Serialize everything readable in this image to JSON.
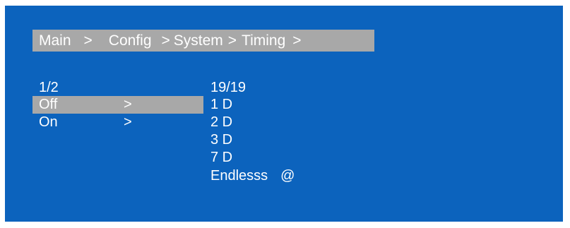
{
  "breadcrumb": {
    "items": [
      "Main",
      ">",
      "Config",
      ">",
      "System",
      ">",
      "Timing",
      ">"
    ]
  },
  "left_menu": {
    "page_indicator": "1/2",
    "items": [
      {
        "label": "Off",
        "arrow": ">",
        "selected": true
      },
      {
        "label": "On",
        "arrow": ">",
        "selected": false
      }
    ]
  },
  "right_menu": {
    "page_indicator": "19/19",
    "items": [
      {
        "label": "1 D",
        "marker": ""
      },
      {
        "label": "2 D",
        "marker": ""
      },
      {
        "label": "3 D",
        "marker": ""
      },
      {
        "label": "7 D",
        "marker": ""
      },
      {
        "label": "Endlesss",
        "marker": "@"
      }
    ]
  },
  "colors": {
    "background": "#0c63bd",
    "highlight": "#a8a8a8",
    "text": "#ffffff"
  }
}
